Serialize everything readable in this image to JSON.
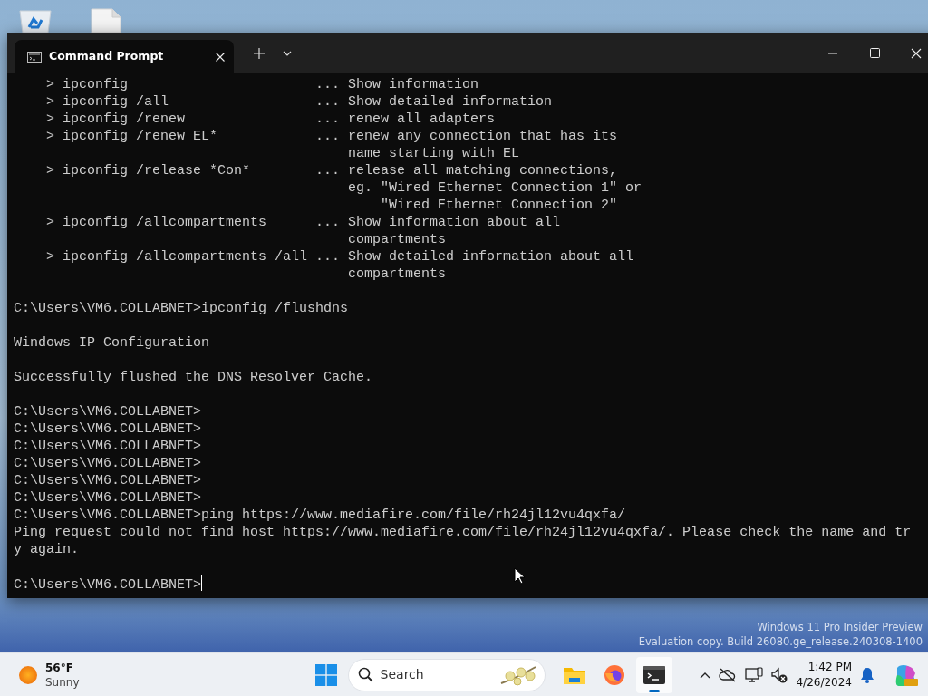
{
  "desktop": {
    "watermark": [
      "Windows 11 Pro Insider Preview",
      "Evaluation copy. Build 26080.ge_release.240308-1400"
    ]
  },
  "window": {
    "tabs": [
      {
        "title": "Command Prompt",
        "selected": true
      }
    ]
  },
  "terminal": {
    "help_entries": [
      {
        "command": "> ipconfig",
        "leader": "...",
        "description": [
          "Show information"
        ]
      },
      {
        "command": "> ipconfig /all",
        "leader": "...",
        "description": [
          "Show detailed information"
        ]
      },
      {
        "command": "> ipconfig /renew",
        "leader": "...",
        "description": [
          "renew all adapters"
        ]
      },
      {
        "command": "> ipconfig /renew EL*",
        "leader": "...",
        "description": [
          "renew any connection that has its",
          "name starting with EL"
        ]
      },
      {
        "command": "> ipconfig /release *Con*",
        "leader": "...",
        "description": [
          "release all matching connections,",
          "eg. \"Wired Ethernet Connection 1\" or",
          "    \"Wired Ethernet Connection 2\""
        ]
      },
      {
        "command": "> ipconfig /allcompartments",
        "leader": "...",
        "description": [
          "Show information about all",
          "compartments"
        ]
      },
      {
        "command": "> ipconfig /allcompartments /all",
        "leader": "...",
        "description": [
          "Show detailed information about all",
          "compartments"
        ]
      }
    ],
    "output_blocks": [
      [
        "C:\\Users\\VM6.COLLABNET>ipconfig /flushdns"
      ],
      [
        "Windows IP Configuration"
      ],
      [
        "Successfully flushed the DNS Resolver Cache."
      ],
      [
        "C:\\Users\\VM6.COLLABNET>",
        "C:\\Users\\VM6.COLLABNET>",
        "C:\\Users\\VM6.COLLABNET>",
        "C:\\Users\\VM6.COLLABNET>",
        "C:\\Users\\VM6.COLLABNET>",
        "C:\\Users\\VM6.COLLABNET>",
        "C:\\Users\\VM6.COLLABNET>ping https://www.mediafire.com/file/rh24jl12vu4qxfa/",
        "Ping request could not find host https://www.mediafire.com/file/rh24jl12vu4qxfa/. Please check the name and tr",
        "y again."
      ]
    ],
    "prompt": "C:\\Users\\VM6.COLLABNET>",
    "cursor_visible": true
  },
  "taskbar": {
    "weather": {
      "temperature": "56°F",
      "condition": "Sunny"
    },
    "search": {
      "label": "Search"
    },
    "apps": [
      {
        "kind": "explorer",
        "selected": false
      },
      {
        "kind": "firefox",
        "selected": false
      },
      {
        "kind": "terminal",
        "selected": true
      }
    ],
    "clock": {
      "time": "1:42 PM",
      "date": "4/26/2024"
    }
  }
}
